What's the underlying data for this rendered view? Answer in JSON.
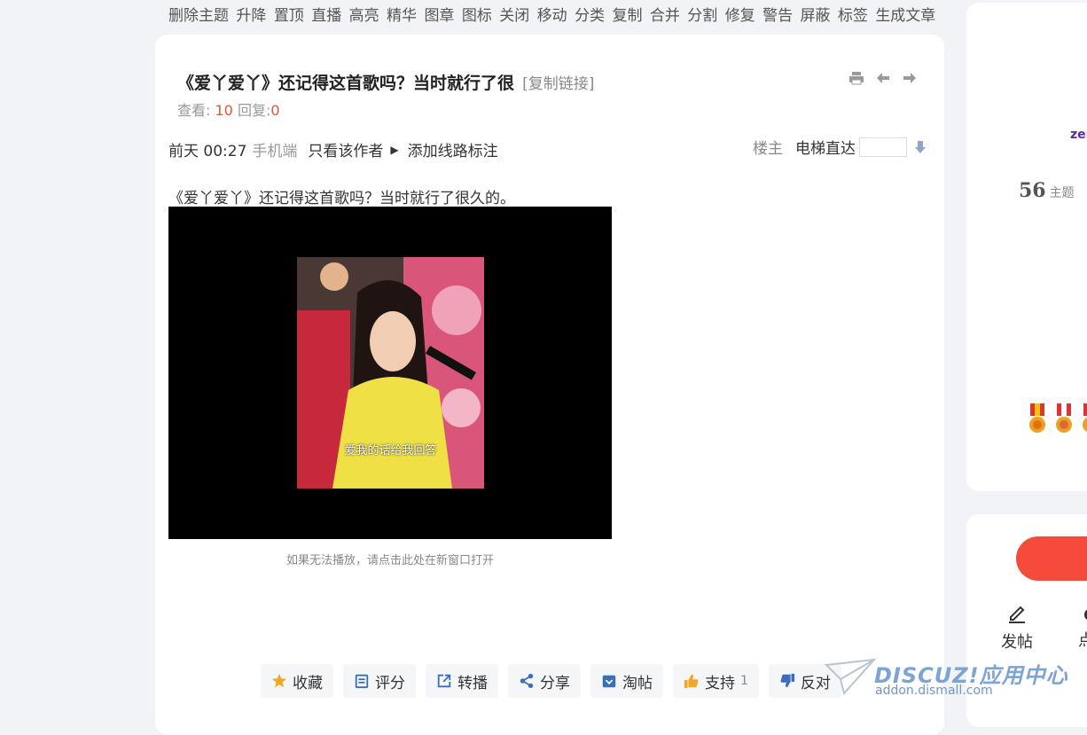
{
  "admin_bar": [
    "删除主题",
    "升降",
    "置顶",
    "直播",
    "高亮",
    "精华",
    "图章",
    "图标",
    "关闭",
    "移动",
    "分类",
    "复制",
    "合并",
    "分割",
    "修复",
    "警告",
    "屏蔽",
    "标签",
    "生成文章"
  ],
  "thread": {
    "title": "《爱丫爱丫》还记得这首歌吗？当时就行了很",
    "copy_link": "[复制链接]",
    "views_label": "查看:",
    "views": "10",
    "replies_label": "回复:",
    "replies": "0"
  },
  "post_meta": {
    "time": "前天 00:27",
    "client": "手机端",
    "only_author": "只看该作者",
    "add_route": "添加线路标注",
    "floor": "楼主",
    "jump_label": "电梯直达"
  },
  "post": {
    "text": "《爱丫爱丫》还记得这首歌吗？当时就行了很久的。",
    "video_subtitle": "爱我的话给我回答",
    "video_hint": "如果无法播放，请点击此处在新窗口打开"
  },
  "actions": [
    {
      "label": "收藏",
      "icon": "star-icon"
    },
    {
      "label": "评分",
      "icon": "rate-icon"
    },
    {
      "label": "转播",
      "icon": "share-out-icon"
    },
    {
      "label": "分享",
      "icon": "share-icon"
    },
    {
      "label": "淘帖",
      "icon": "collect-icon"
    },
    {
      "label": "支持",
      "icon": "thumbs-up-icon",
      "count": "1"
    },
    {
      "label": "反对",
      "icon": "thumbs-down-icon"
    }
  ],
  "sidebar": {
    "username": "zer",
    "thread_count": "56",
    "thread_count_label": "主题",
    "post_button": "发帖",
    "partial_label": "点"
  },
  "watermark": {
    "brand": "DISCUZ!应用中心",
    "site": "addon.dismall.com"
  },
  "colors": {
    "accent": "#e5533d",
    "pill": "#f64b3c",
    "username": "#5b2a9c"
  }
}
